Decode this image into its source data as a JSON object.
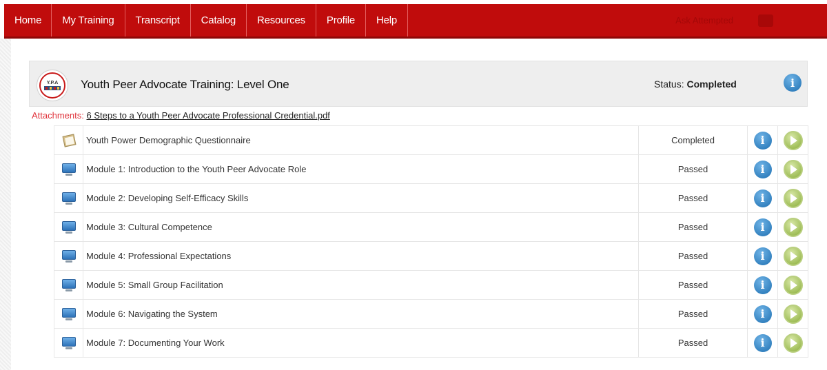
{
  "nav": {
    "items": [
      "Home",
      "My Training",
      "Transcript",
      "Catalog",
      "Resources",
      "Profile",
      "Help"
    ],
    "right_text": "Ask Attempted"
  },
  "course": {
    "title": "Youth Peer Advocate Training: Level One",
    "status_label": "Status:",
    "status_value": "Completed",
    "logo_text": "Y.P.A"
  },
  "attachments": {
    "label": "Attachments:",
    "file": "6 Steps to a Youth Peer Advocate Professional Credential.pdf"
  },
  "modules": [
    {
      "title": "Youth Power Demographic Questionnaire",
      "status": "Completed",
      "icon": "clipboard-icon"
    },
    {
      "title": "Module 1: Introduction to the Youth Peer Advocate Role",
      "status": "Passed",
      "icon": "monitor-icon"
    },
    {
      "title": "Module 2: Developing Self-Efficacy Skills",
      "status": "Passed",
      "icon": "monitor-icon"
    },
    {
      "title": "Module 3: Cultural Competence",
      "status": "Passed",
      "icon": "monitor-icon"
    },
    {
      "title": "Module 4: Professional Expectations",
      "status": "Passed",
      "icon": "monitor-icon"
    },
    {
      "title": "Module 5: Small Group Facilitation",
      "status": "Passed",
      "icon": "monitor-icon"
    },
    {
      "title": "Module 6: Navigating the System",
      "status": "Passed",
      "icon": "monitor-icon"
    },
    {
      "title": "Module 7: Documenting Your Work",
      "status": "Passed",
      "icon": "monitor-icon"
    }
  ],
  "colors": {
    "nav_bg": "#c00c0c",
    "attach_label": "#e0353d",
    "info": "#1d6fb1",
    "play": "#8aae3a"
  }
}
